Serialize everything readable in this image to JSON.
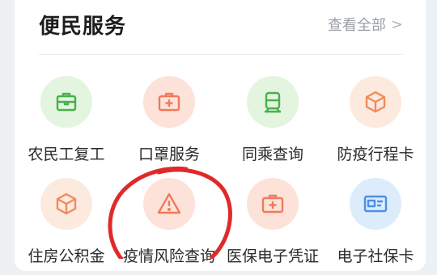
{
  "section": {
    "title": "便民服务",
    "view_all_label": "查看全部",
    "chevron": ">"
  },
  "services": [
    {
      "label": "农民工复工",
      "icon": "briefcase-icon",
      "bg": "#e3f4df",
      "fg": "#49b04b"
    },
    {
      "label": "口罩服务",
      "icon": "medical-kit-icon",
      "bg": "#fde2d9",
      "fg": "#f07a5a"
    },
    {
      "label": "同乘查询",
      "icon": "train-icon",
      "bg": "#e3f4df",
      "fg": "#49b04b"
    },
    {
      "label": "防疫行程卡",
      "icon": "cube-icon",
      "bg": "#fdeade",
      "fg": "#f08a5d"
    },
    {
      "label": "住房公积金",
      "icon": "cube-icon",
      "bg": "#fdeade",
      "fg": "#f08a5d"
    },
    {
      "label": "疫情风险查询",
      "icon": "warning-icon",
      "bg": "#fde2d9",
      "fg": "#f07a5a"
    },
    {
      "label": "医保电子凭证",
      "icon": "medical-kit-icon",
      "bg": "#fde2d9",
      "fg": "#f07a5a"
    },
    {
      "label": "电子社保卡",
      "icon": "id-card-icon",
      "bg": "#dcecfb",
      "fg": "#4f8fe6"
    }
  ],
  "annotation_color": "#e02a2a"
}
